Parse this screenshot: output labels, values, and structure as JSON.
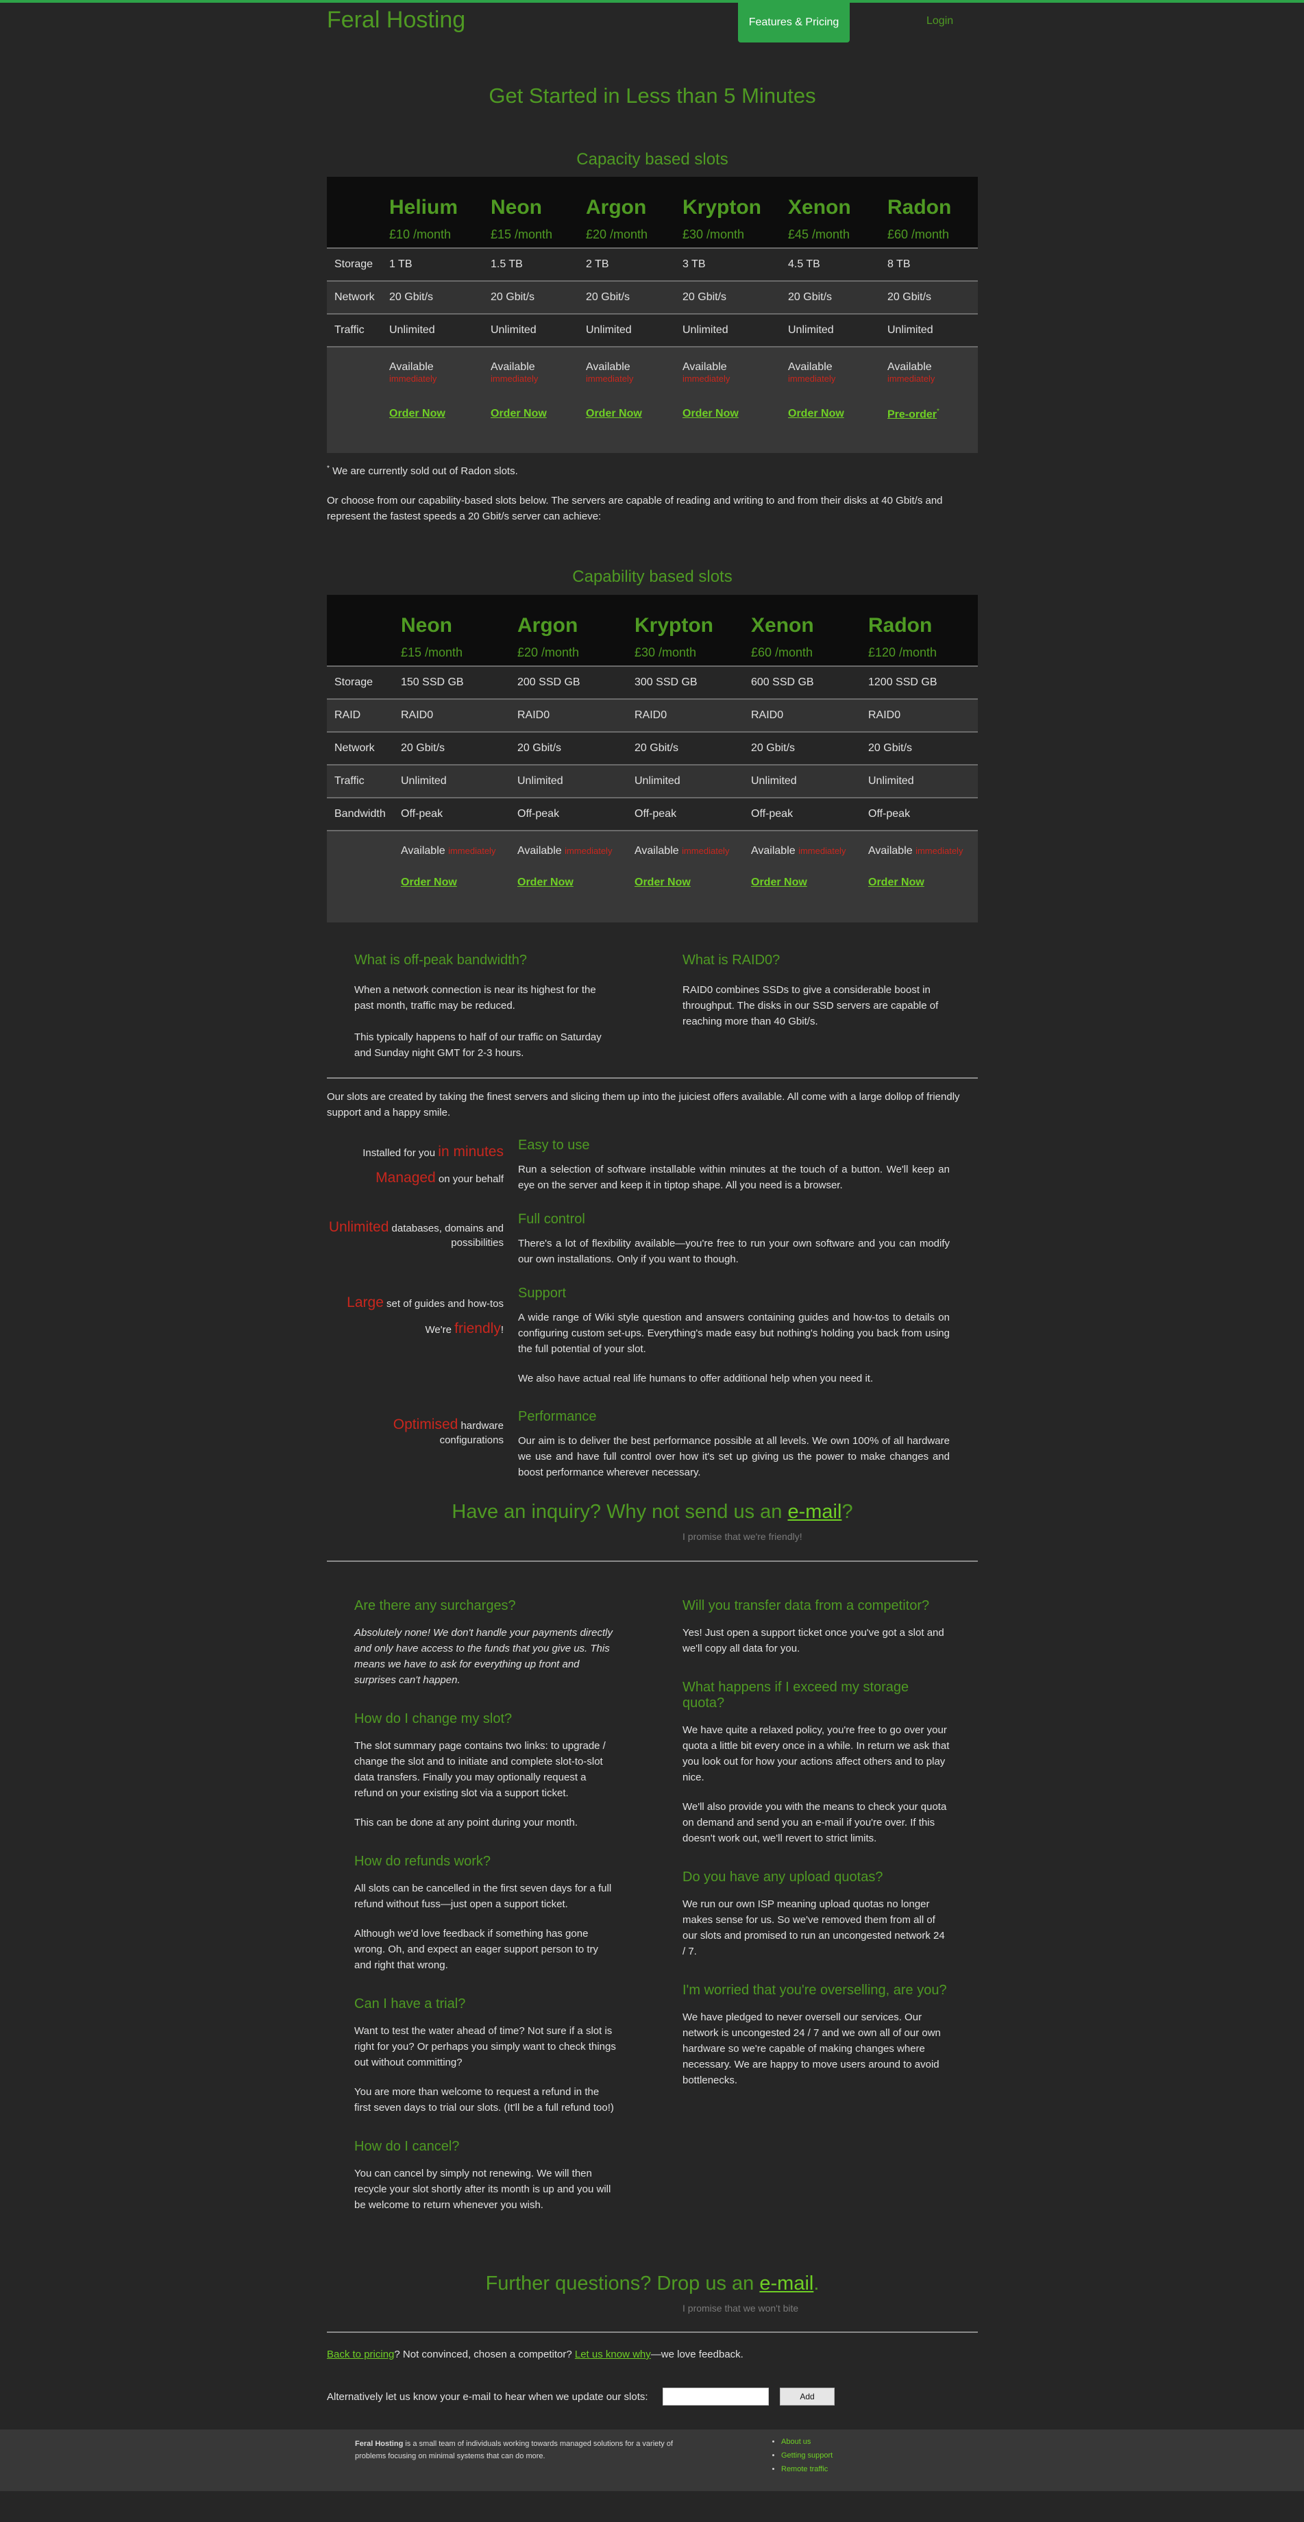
{
  "header": {
    "logo": "Feral Hosting",
    "nav": [
      {
        "label": "Features & Pricing",
        "active": true
      },
      {
        "label": "Login",
        "active": false
      }
    ],
    "accent_color": "#2ea349"
  },
  "hero_title": "Get Started in Less than 5 Minutes",
  "capacity": {
    "title": "Capacity based slots",
    "plans": [
      {
        "name": "Helium",
        "price": "£10 /month"
      },
      {
        "name": "Neon",
        "price": "£15 /month"
      },
      {
        "name": "Argon",
        "price": "£20 /month"
      },
      {
        "name": "Krypton",
        "price": "£30 /month"
      },
      {
        "name": "Xenon",
        "price": "£45 /month"
      },
      {
        "name": "Radon",
        "price": "£60 /month"
      }
    ],
    "rows": [
      {
        "label": "Storage",
        "values": [
          "1 TB",
          "1.5 TB",
          "2 TB",
          "3 TB",
          "4.5 TB",
          "8 TB"
        ]
      },
      {
        "label": "Network",
        "values": [
          "20 Gbit/s",
          "20 Gbit/s",
          "20 Gbit/s",
          "20 Gbit/s",
          "20 Gbit/s",
          "20 Gbit/s"
        ]
      },
      {
        "label": "Traffic",
        "values": [
          "Unlimited",
          "Unlimited",
          "Unlimited",
          "Unlimited",
          "Unlimited",
          "Unlimited"
        ]
      }
    ],
    "availability": "Available",
    "availability_sub": "immediately",
    "order_labels": [
      "Order Now",
      "Order Now",
      "Order Now",
      "Order Now",
      "Order Now",
      "Pre-order"
    ],
    "preorder_mark": "*",
    "footnote_mark": "*",
    "footnote": "We are currently sold out of Radon slots."
  },
  "capability_intro": "Or choose from our capability-based slots below. The servers are capable of reading and writing to and from their disks at 40 Gbit/s and represent the fastest speeds a 20 Gbit/s server can achieve:",
  "capability": {
    "title": "Capability based slots",
    "plans": [
      {
        "name": "Neon",
        "price": "£15 /month"
      },
      {
        "name": "Argon",
        "price": "£20 /month"
      },
      {
        "name": "Krypton",
        "price": "£30 /month"
      },
      {
        "name": "Xenon",
        "price": "£60 /month"
      },
      {
        "name": "Radon",
        "price": "£120 /month"
      }
    ],
    "rows": [
      {
        "label": "Storage",
        "values": [
          "150 SSD GB",
          "200 SSD GB",
          "300 SSD GB",
          "600 SSD GB",
          "1200 SSD GB"
        ]
      },
      {
        "label": "RAID",
        "values": [
          "RAID0",
          "RAID0",
          "RAID0",
          "RAID0",
          "RAID0"
        ]
      },
      {
        "label": "Network",
        "values": [
          "20 Gbit/s",
          "20 Gbit/s",
          "20 Gbit/s",
          "20 Gbit/s",
          "20 Gbit/s"
        ]
      },
      {
        "label": "Traffic",
        "values": [
          "Unlimited",
          "Unlimited",
          "Unlimited",
          "Unlimited",
          "Unlimited"
        ]
      },
      {
        "label": "Bandwidth",
        "values": [
          "Off-peak",
          "Off-peak",
          "Off-peak",
          "Off-peak",
          "Off-peak"
        ]
      }
    ],
    "availability": "Available",
    "availability_sub": "immediately",
    "order_label": "Order Now"
  },
  "explain": {
    "offpeak_title": "What is off-peak bandwidth?",
    "offpeak_p1": "When a network connection is near its highest for the past month, traffic may be reduced.",
    "offpeak_p2": "This typically happens to half of our traffic on Saturday and Sunday night GMT for 2-3 hours.",
    "raid_title": "What is RAID0?",
    "raid_p1": "RAID0 combines SSDs to give a considerable boost in throughput. The disks in our SSD servers are capable of reaching more than 40 Gbit/s."
  },
  "slots_intro": "Our slots are created by taking the finest servers and slicing them up into the juiciest offers available. All come with a large dollop of friendly support and a happy smile.",
  "taglines": {
    "installed_pre": "Installed for you ",
    "installed_hl": "in minutes",
    "managed_hl": "Managed",
    "managed_post": " on your behalf",
    "unlimited_hl": "Unlimited",
    "unlimited_post": " databases, domains and possibilities",
    "large_hl": "Large",
    "large_post": " set of guides and how-tos",
    "friendly_pre": "We're ",
    "friendly_hl": "friendly",
    "friendly_post": "!",
    "optimised_hl": "Optimised",
    "optimised_post": " hardware configurations"
  },
  "features": [
    {
      "title": "Easy to use",
      "paras": [
        "Run a selection of software installable within minutes at the touch of a button. We'll keep an eye on the server and keep it in tiptop shape. All you need is a browser."
      ]
    },
    {
      "title": "Full control",
      "paras": [
        "There's a lot of flexibility available—you're free to run your own software and you can modify our own installations. Only if you want to though."
      ]
    },
    {
      "title": "Support",
      "paras": [
        "A wide range of Wiki style question and answers containing guides and how-tos to details on configuring custom set-ups. Everything's made easy but nothing's holding you back from using the full potential of your slot.",
        "We also have actual real life humans to offer additional help when you need it."
      ]
    },
    {
      "title": "Performance",
      "paras": [
        "Our aim is to deliver the best performance possible at all levels. We own 100% of all hardware we use and have full control over how it's set up giving us the power to make changes and boost performance wherever necessary."
      ]
    }
  ],
  "inquiry": {
    "pre": "Have an inquiry? Why not send us an ",
    "link": "e-mail",
    "post": "?",
    "promise": "I promise that we're friendly!"
  },
  "faq_left": [
    {
      "q": "Are there any surcharges?",
      "a": [
        "Absolutely none! We don't handle your payments directly and only have access to the funds that you give us. This means we have to ask for everything up front and surprises can't happen."
      ]
    },
    {
      "q": "How do I change my slot?",
      "a": [
        "The slot summary page contains two links: to upgrade / change the slot and to initiate and complete slot-to-slot data transfers. Finally you may optionally request a refund on your existing slot via a support ticket.",
        "This can be done at any point during your month."
      ]
    },
    {
      "q": "How do refunds work?",
      "a": [
        "All slots can be cancelled in the first seven days for a full refund without fuss—just open a support ticket.",
        "Although we'd love feedback if something has gone wrong. Oh, and expect an eager support person to try and right that wrong."
      ]
    },
    {
      "q": "Can I have a trial?",
      "a": [
        "Want to test the water ahead of time? Not sure if a slot is right for you? Or perhaps you simply want to check things out without committing?",
        "You are more than welcome to request a refund in the first seven days to trial our slots. (It'll be a full refund too!)"
      ]
    },
    {
      "q": "How do I cancel?",
      "a": [
        "You can cancel by simply not renewing. We will then recycle your slot shortly after its month is up and you will be welcome to return whenever you wish."
      ]
    }
  ],
  "faq_right": [
    {
      "q": "Will you transfer data from a competitor?",
      "a": [
        "Yes! Just open a support ticket once you've got a slot and we'll copy all data for you."
      ]
    },
    {
      "q": "What happens if I exceed my storage quota?",
      "a": [
        "We have quite a relaxed policy, you're free to go over your quota a little bit every once in a while. In return we ask that you look out for how your actions affect others and to play nice.",
        "We'll also provide you with the means to check your quota on demand and send you an e-mail if you're over. If this doesn't work out, we'll revert to strict limits."
      ]
    },
    {
      "q": "Do you have any upload quotas?",
      "a": [
        "We run our own ISP meaning upload quotas no longer makes sense for us. So we've removed them from all of our slots and promised to run an uncongested network 24 / 7."
      ]
    },
    {
      "q": "I'm worried that you're overselling, are you?",
      "a": [
        "We have pledged to never oversell our services. Our network is uncongested 24 / 7 and we own all of our own hardware so we're capable of making changes where necessary. We are happy to move users around to avoid bottlenecks."
      ]
    }
  ],
  "further": {
    "pre": "Further questions? Drop us an ",
    "link": "e-mail",
    "post": ".",
    "promise": "I promise that we won't bite"
  },
  "back_line": {
    "link1": "Back to pricing",
    "mid": "? Not convinced, chosen a competitor? ",
    "link2": "Let us know why",
    "post": "—we love feedback."
  },
  "notify": {
    "label": "Alternatively let us know your e-mail to hear when we update our slots:",
    "placeholder": "",
    "button": "Add"
  },
  "footer": {
    "brand": "Feral Hosting",
    "text": " is a small team of individuals working towards managed solutions for a variety of problems focusing on minimal systems that can do more.",
    "links": [
      "About us",
      "Getting support",
      "Remote traffic"
    ]
  }
}
